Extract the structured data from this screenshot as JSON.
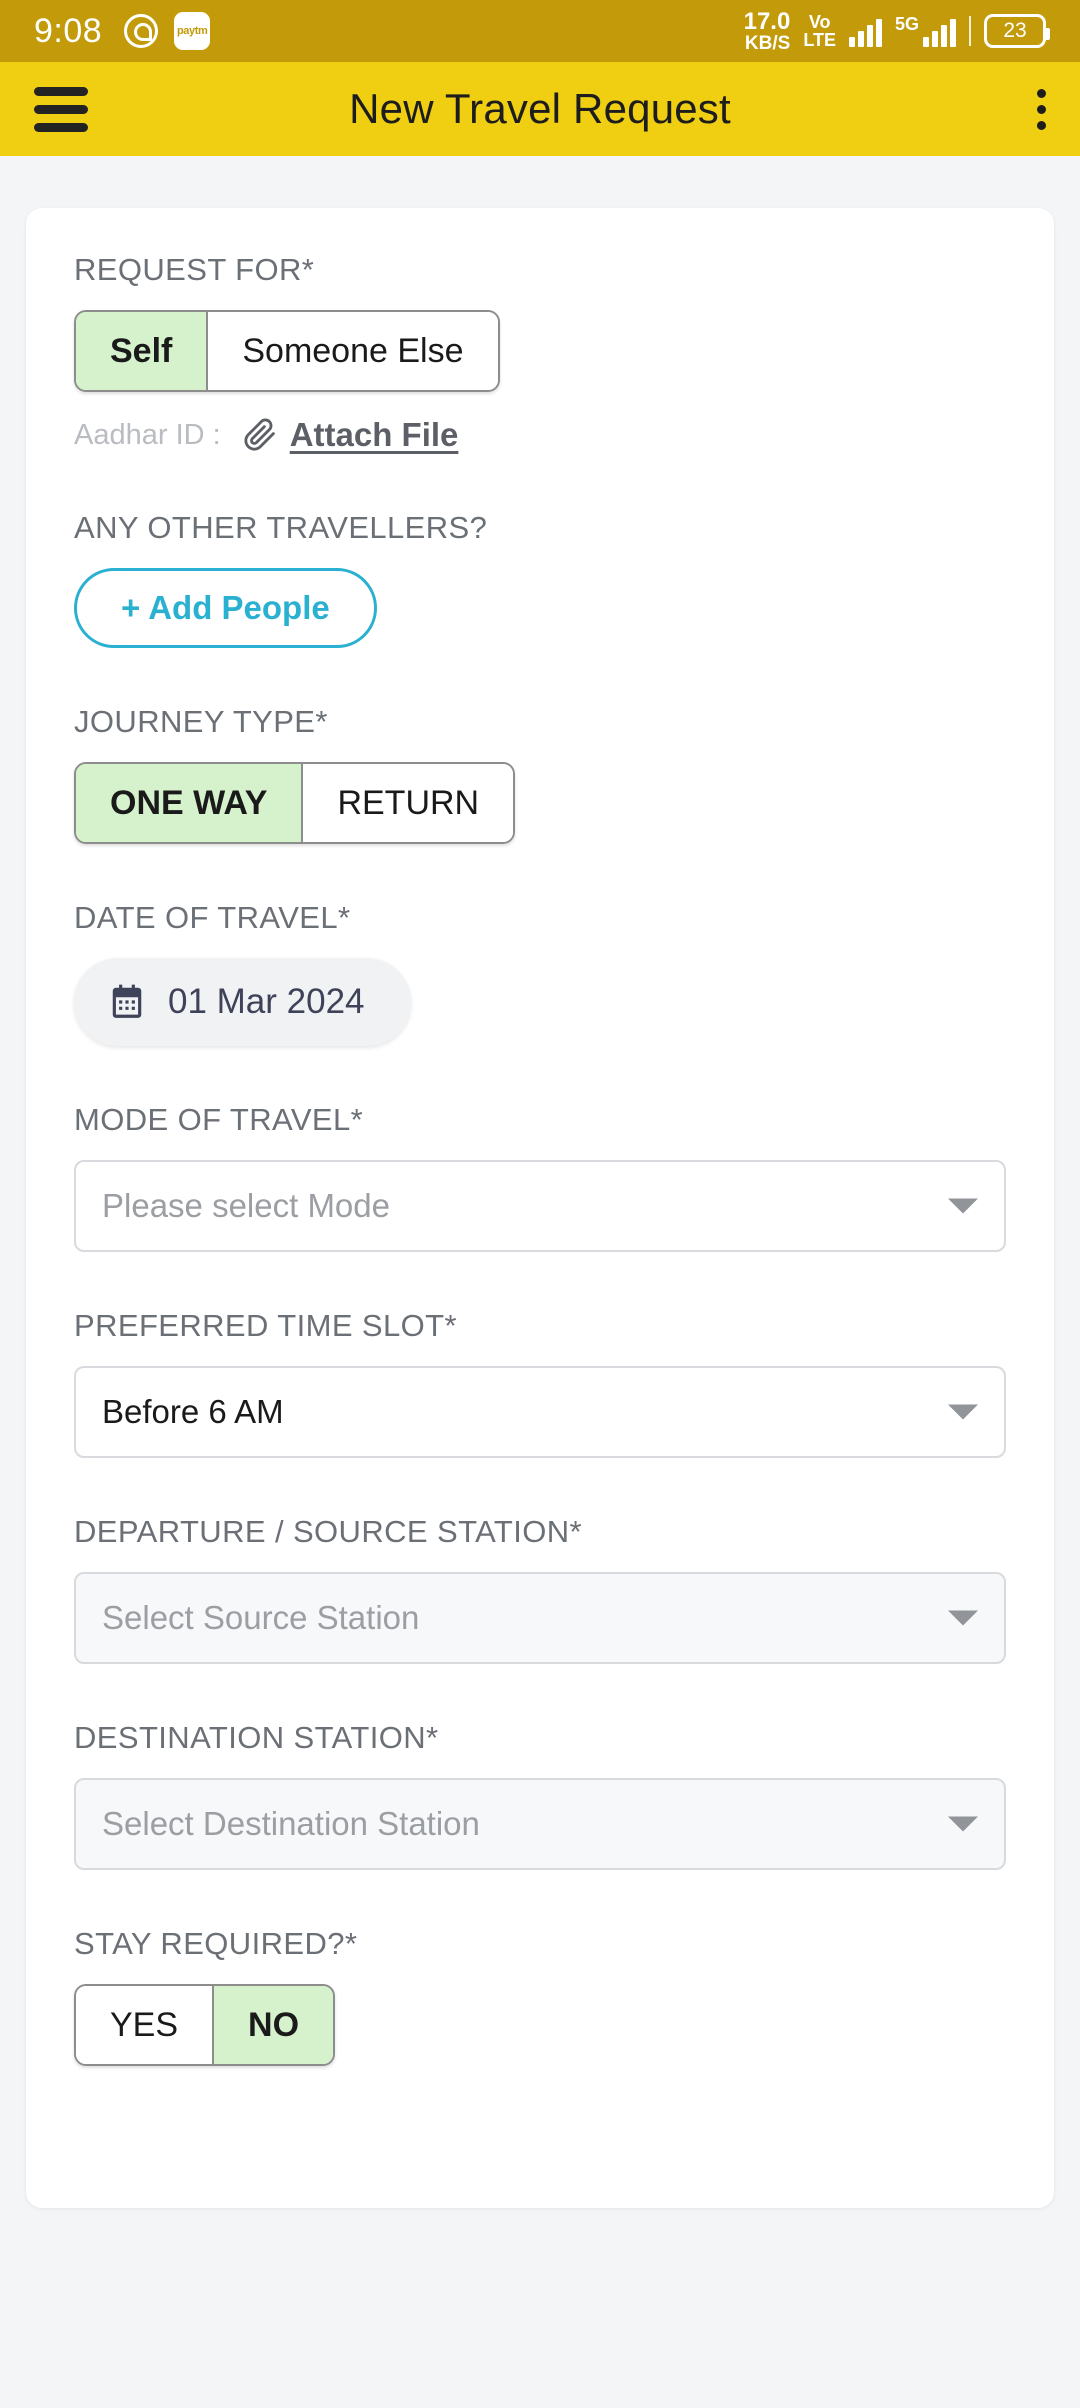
{
  "status_bar": {
    "time": "9:08",
    "whatsapp_icon": "whatsapp-icon",
    "paytm_label": "paytm",
    "net_speed_value": "17.0",
    "net_speed_unit": "KB/S",
    "volte_line1": "Vo",
    "volte_line2": "LTE",
    "network_type": "5G",
    "battery_level": "23"
  },
  "app_bar": {
    "title": "New Travel Request",
    "menu_icon": "hamburger-menu-icon",
    "overflow_icon": "overflow-menu-icon",
    "background_color": "#f0ce11"
  },
  "form": {
    "request_for": {
      "label": "REQUEST FOR*",
      "options": [
        "Self",
        "Someone Else"
      ],
      "selected": "Self",
      "aadhar_label": "Aadhar ID :",
      "attach_label": "Attach File",
      "attach_icon": "paperclip-icon"
    },
    "other_travellers": {
      "label": "ANY OTHER TRAVELLERS?",
      "add_button": "+ Add People",
      "accent_color": "#2ab0d0"
    },
    "journey_type": {
      "label": "JOURNEY TYPE*",
      "options": [
        "ONE WAY",
        "RETURN"
      ],
      "selected": "ONE WAY"
    },
    "date_of_travel": {
      "label": "DATE OF TRAVEL*",
      "value": "01 Mar 2024",
      "icon": "calendar-icon"
    },
    "mode_of_travel": {
      "label": "MODE OF TRAVEL*",
      "placeholder": "Please select Mode",
      "value": "",
      "display": "Please select Mode"
    },
    "preferred_time_slot": {
      "label": "PREFERRED TIME SLOT*",
      "value": "Before 6 AM"
    },
    "source_station": {
      "label": "DEPARTURE / SOURCE STATION*",
      "placeholder": "Select Source Station",
      "display": "Select Source Station"
    },
    "destination_station": {
      "label": "DESTINATION STATION*",
      "placeholder": "Select Destination Station",
      "display": "Select Destination Station"
    },
    "stay_required": {
      "label": "STAY REQUIRED?*",
      "options": [
        "YES",
        "NO"
      ],
      "selected": "NO"
    }
  },
  "colors": {
    "selected_green": "#d6f2cc",
    "accent_cyan": "#2ab0d0",
    "app_bar_yellow": "#f0ce11",
    "status_bar_yellow": "#c39a09"
  }
}
